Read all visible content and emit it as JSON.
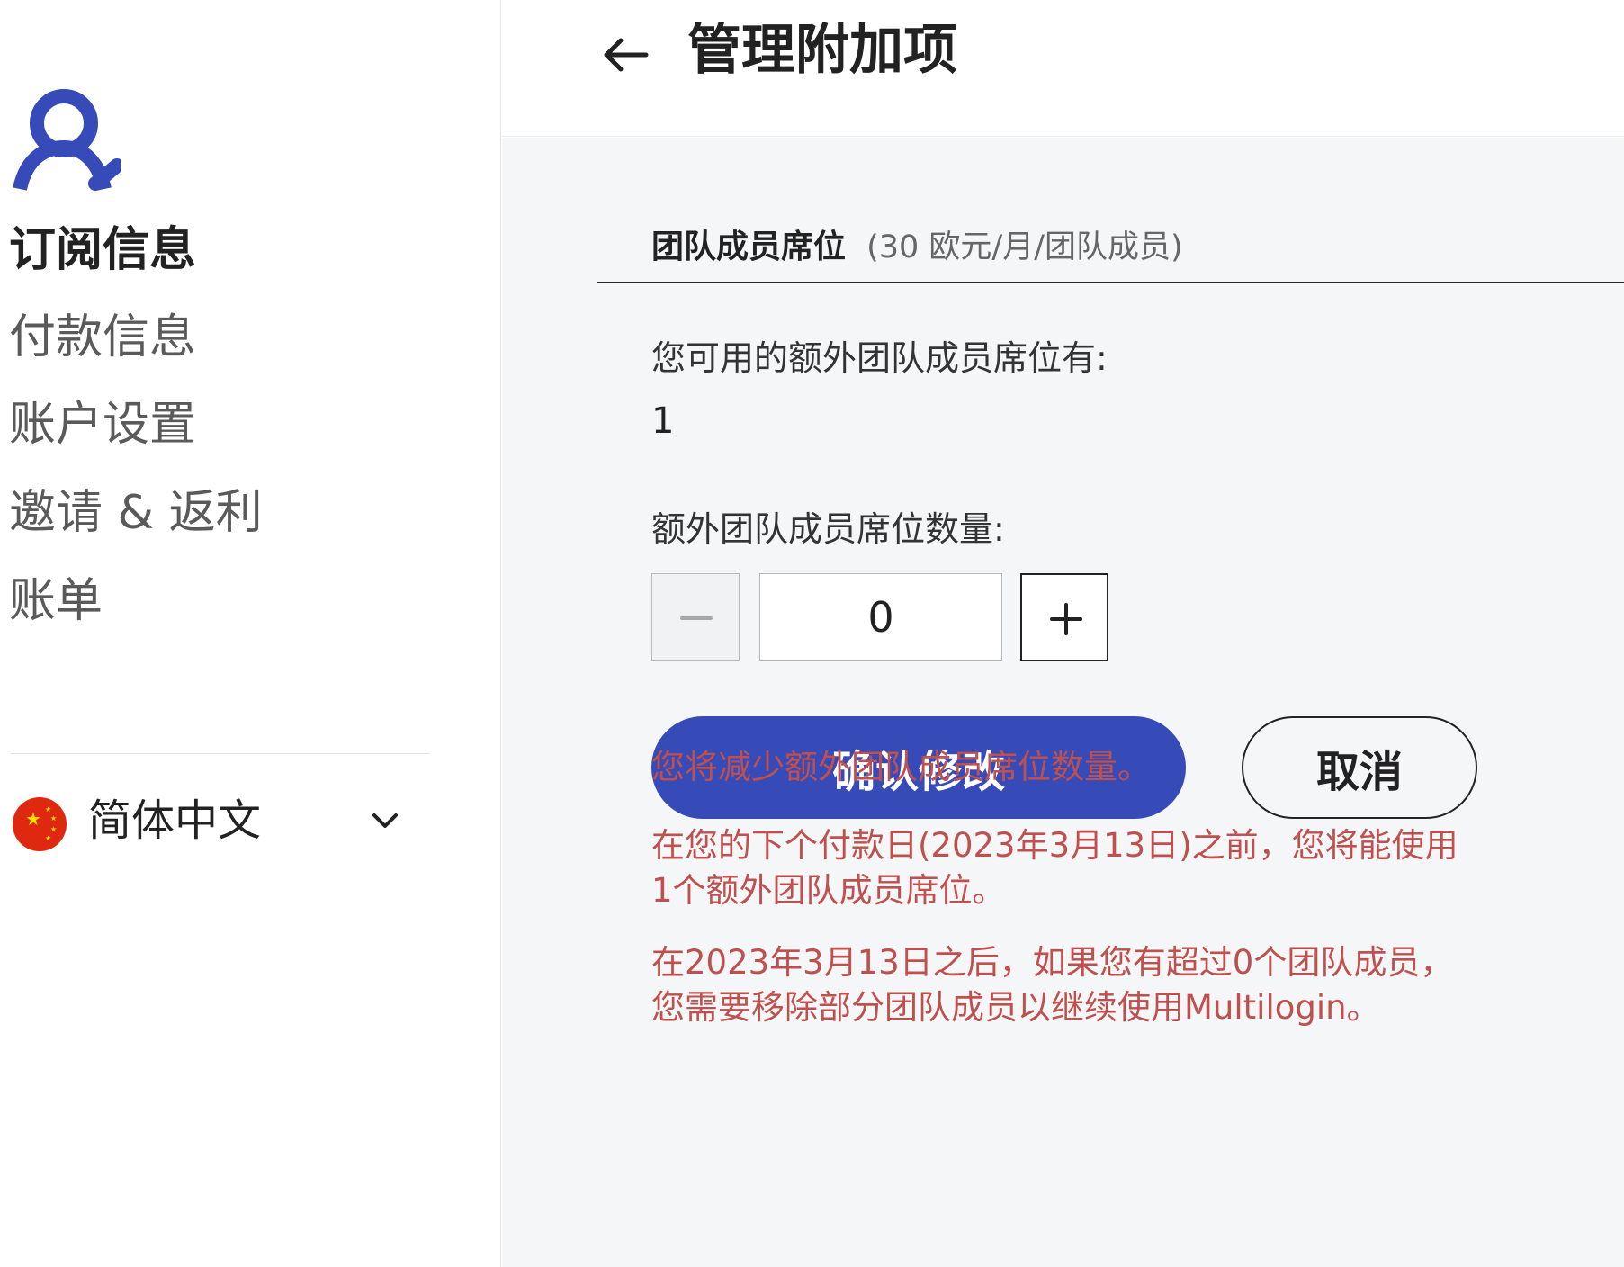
{
  "sidebar": {
    "nav": [
      {
        "label": "订阅信息",
        "active": true
      },
      {
        "label": "付款信息",
        "active": false
      },
      {
        "label": "账户设置",
        "active": false
      },
      {
        "label": "邀请 & 返利",
        "active": false
      },
      {
        "label": "账单",
        "active": false
      }
    ],
    "language": {
      "label": "简体中文",
      "flag": "china-flag-icon"
    }
  },
  "header": {
    "title": "管理附加项",
    "back_icon": "arrow-left-icon"
  },
  "section": {
    "title": "团队成员席位",
    "price": "(30 欧元/月/团队成员)",
    "available_label": "您可用的额外团队成员席位有:",
    "available_value": "1",
    "quantity_label": "额外团队成员席位数量:",
    "quantity_value": "0"
  },
  "actions": {
    "confirm_label": "确认修改",
    "cancel_label": "取消"
  },
  "notices": {
    "line1": "您将减少额外团队成员席位数量。",
    "line2": "在您的下个付款日(2023年3月13日)之前，您将能使用1个额外团队成员席位。",
    "line3": "在2023年3月13日之后，如果您有超过0个团队成员，您需要移除部分团队成员以继续使用Multilogin。"
  },
  "colors": {
    "accent": "#364ab8",
    "warning": "#c0504d",
    "background": "#f5f6f8"
  }
}
